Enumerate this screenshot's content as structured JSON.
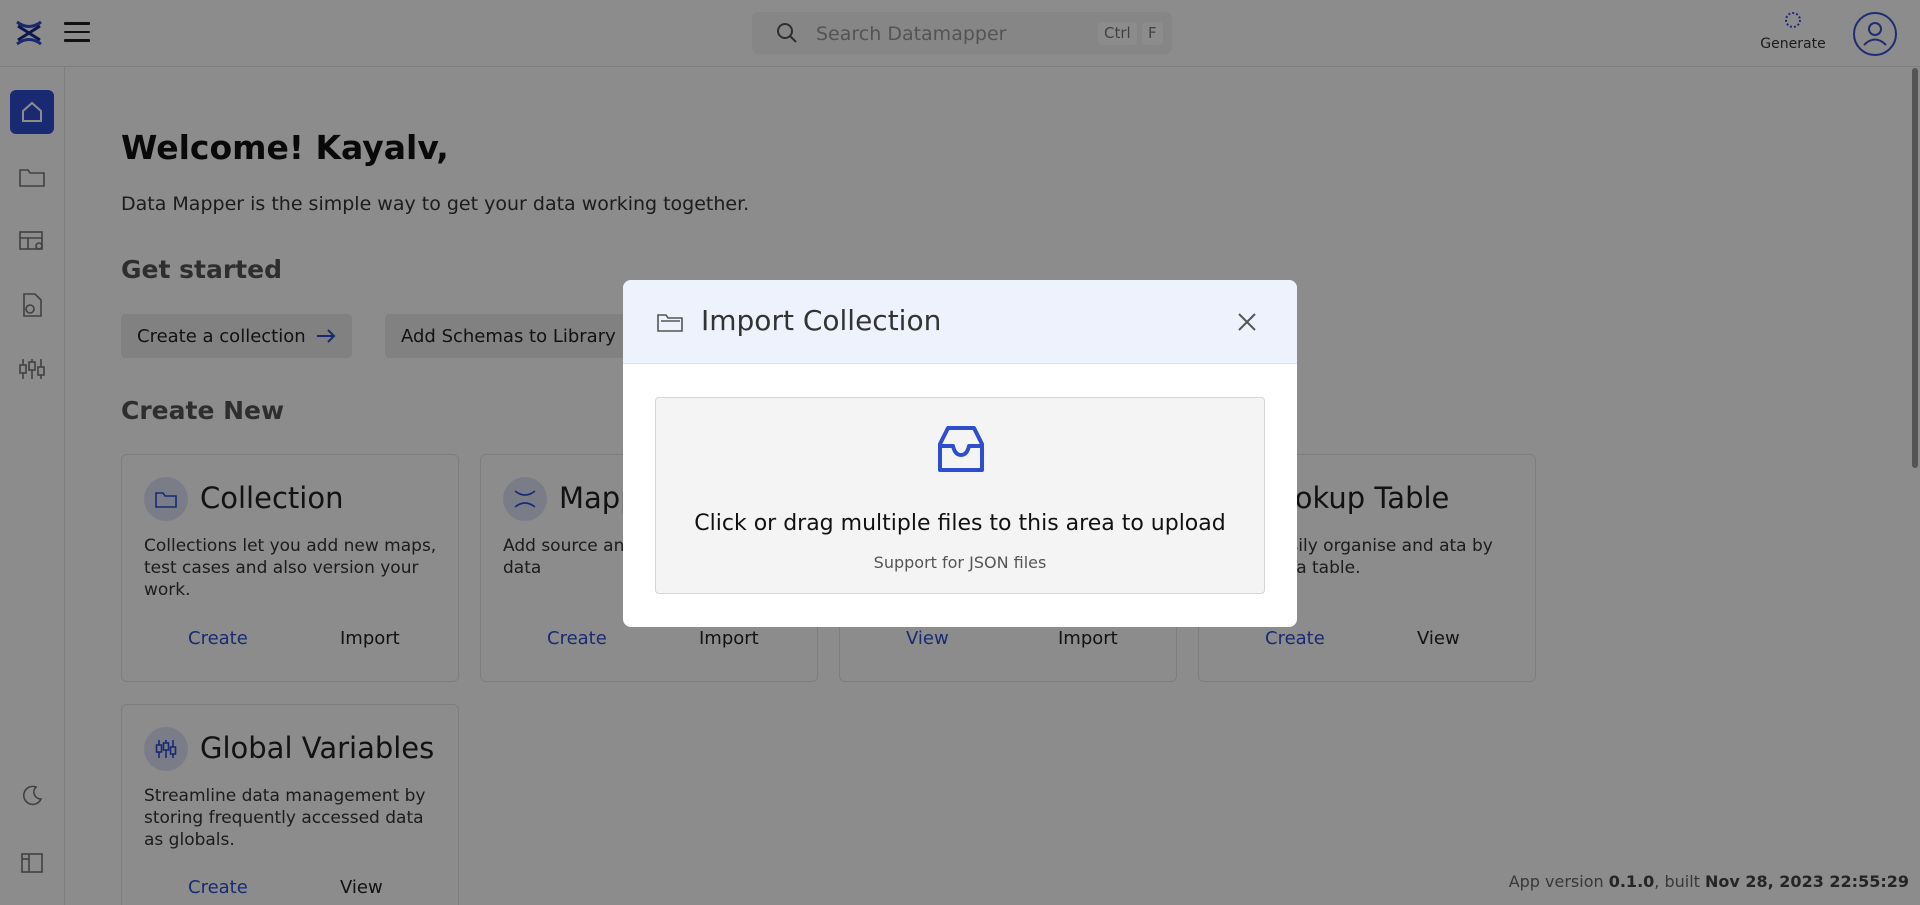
{
  "search": {
    "placeholder": "Search Datamapper",
    "kbd1": "Ctrl",
    "kbd2": "F"
  },
  "header": {
    "generate_label": "Generate"
  },
  "main": {
    "welcome": "Welcome! Kayalv,",
    "tagline": "Data Mapper is the simple way to get your data working together.",
    "get_started": "Get started",
    "quick_actions": [
      "Create a collection",
      "Add Schemas to Library"
    ],
    "create_new": "Create New",
    "cards": [
      {
        "title": "Collection",
        "desc": "Collections let you add new maps, test cases and also version your work.",
        "a1": "Create",
        "a2": "Import"
      },
      {
        "title": "Mapp",
        "desc": "Add source and start mapping data",
        "a1": "Create",
        "a2": "Import"
      },
      {
        "title": "",
        "desc": "",
        "a1": "View",
        "a2": "Import"
      },
      {
        "title": "ookup Table",
        "desc": "ps to easily organise and ata by creating a table.",
        "a1": "Create",
        "a2": "View"
      },
      {
        "title": "Global Variables",
        "desc": "Streamline data management by storing frequently accessed data as globals.",
        "a1": "Create",
        "a2": "View"
      }
    ]
  },
  "footer": {
    "version_prefix": "App version ",
    "version": "0.1.0",
    "built_prefix": ", built ",
    "built": "Nov 28, 2023 22:55:29"
  },
  "modal": {
    "title": "Import Collection",
    "drop_main": "Click or drag multiple files to this area to upload",
    "drop_sub": "Support for JSON files"
  },
  "colors": {
    "accent": "#2f4ecf",
    "modal_header": "#eef2fd"
  }
}
